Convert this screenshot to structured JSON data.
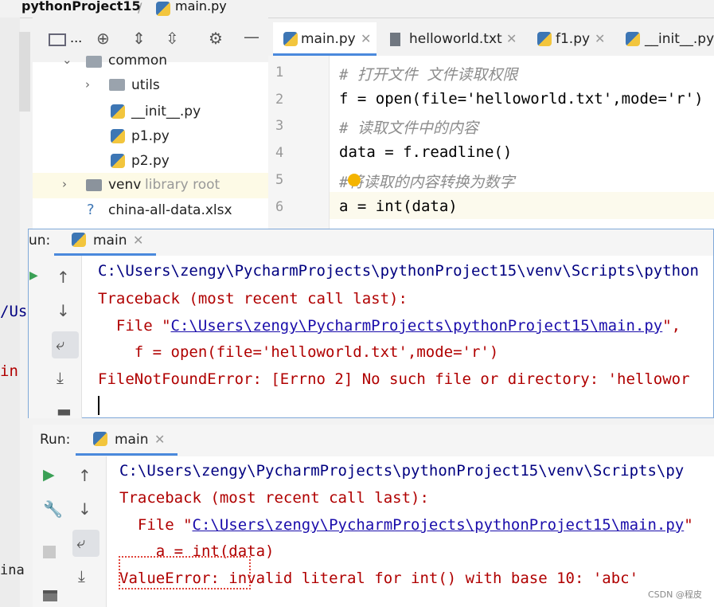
{
  "breadcrumb": {
    "project": "pythonProject15",
    "file": "main.py"
  },
  "project_toolbar": {
    "collapsed_label": "..."
  },
  "tree": {
    "items": [
      {
        "label": "common"
      },
      {
        "label": "utils"
      },
      {
        "label": "__init__.py"
      },
      {
        "label": "p1.py"
      },
      {
        "label": "p2.py"
      },
      {
        "label": "venv",
        "hint": "library root"
      },
      {
        "label": "china-all-data.xlsx"
      }
    ]
  },
  "tabs": [
    {
      "label": "main.py"
    },
    {
      "label": "helloworld.txt"
    },
    {
      "label": "f1.py"
    },
    {
      "label": "__init__.py"
    }
  ],
  "editor": {
    "lines": [
      {
        "num": "1",
        "text": "# 打开文件 文件读取权限"
      },
      {
        "num": "2",
        "text": "f = open(file='helloworld.txt',mode='r')"
      },
      {
        "num": "3",
        "text": "# 读取文件中的内容"
      },
      {
        "num": "4",
        "text": "data = f.readline()"
      },
      {
        "num": "5",
        "text": "#将读取的内容转换为数字"
      },
      {
        "num": "6",
        "text": "a = int(data)"
      }
    ]
  },
  "run1": {
    "label_prefix": "un:",
    "tab": "main",
    "output": [
      "C:\\Users\\zengy\\PycharmProjects\\pythonProject15\\venv\\Scripts\\python",
      "Traceback (most recent call last):",
      "  File \"C:\\Users\\zengy\\PycharmProjects\\pythonProject15\\main.py\",",
      "    f = open(file='helloworld.txt',mode='r')",
      "FileNotFoundError: [Errno 2] No such file or directory: 'hellowor"
    ],
    "link": "C:\\Users\\zengy\\PycharmProjects\\pythonProject15\\main.py"
  },
  "run2": {
    "label": "Run:",
    "tab": "main",
    "output": [
      "C:\\Users\\zengy\\PycharmProjects\\pythonProject15\\venv\\Scripts\\py",
      "Traceback (most recent call last):",
      "  File \"C:\\Users\\zengy\\PycharmProjects\\pythonProject15\\main.py\"",
      "    a = int(data)",
      "ValueError: invalid literal for int() with base 10: 'abc'"
    ],
    "link": "C:\\Users\\zengy\\PycharmProjects\\pythonProject15\\main.py"
  },
  "side_fragments": {
    "us": "/Us",
    "in": "in",
    "ina": "ina"
  },
  "watermark": "CSDN @程皮"
}
